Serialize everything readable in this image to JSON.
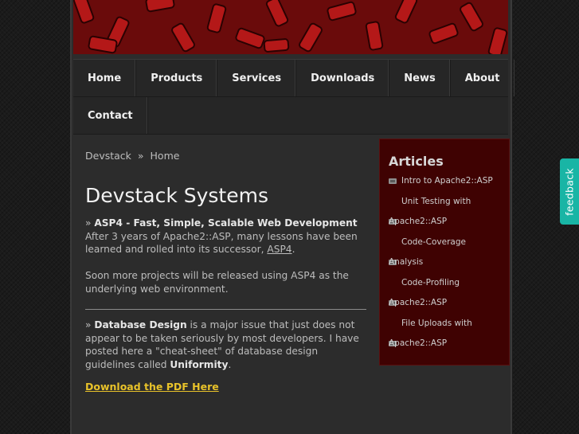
{
  "nav": {
    "row1": [
      {
        "label": "Home"
      },
      {
        "label": "Products"
      },
      {
        "label": "Services"
      },
      {
        "label": "Downloads"
      },
      {
        "label": "News"
      },
      {
        "label": "About"
      }
    ],
    "row2": [
      {
        "label": "Contact"
      }
    ]
  },
  "breadcrumb": {
    "site": "Devstack",
    "separator": "»",
    "current": "Home"
  },
  "page_title": "Devstack Systems",
  "section1": {
    "marker": "»",
    "heading": "ASP4 - Fast, Simple, Scalable Web Development",
    "body_before_link": "After 3 years of Apache2::ASP, many lessons have been learned and rolled into its successor,",
    "link": "ASP4",
    "body_after_link": ".",
    "para2": "Soon more projects will be released using ASP4 as the underlying web environment."
  },
  "section2": {
    "marker": "»",
    "heading": "Database Design",
    "body": "is a major issue that just does not appear to be taken seriously by most developers. I have posted here a \"cheat-sheet\" of database design guidelines called",
    "bold_term": "Uniformity",
    "end": "."
  },
  "download_link": "Download the PDF Here",
  "sidebar": {
    "title": "Articles",
    "items": [
      {
        "line1": "Intro to Apache2::ASP"
      },
      {
        "line1": "Unit Testing with",
        "line2": "Apache2::ASP"
      },
      {
        "line1": "Code-Coverage",
        "line2": "Analysis"
      },
      {
        "line1": "Code-Profiling",
        "line2": "Apache2::ASP"
      },
      {
        "line1": "File Uploads with",
        "line2": "Apache2::ASP"
      }
    ]
  },
  "feedback": "feedback",
  "colors": {
    "banner": "#6d0c0c",
    "sidebar_bg": "#3f0202",
    "link_yellow": "#e8c22a",
    "feedback_tab": "#19b5a5"
  }
}
